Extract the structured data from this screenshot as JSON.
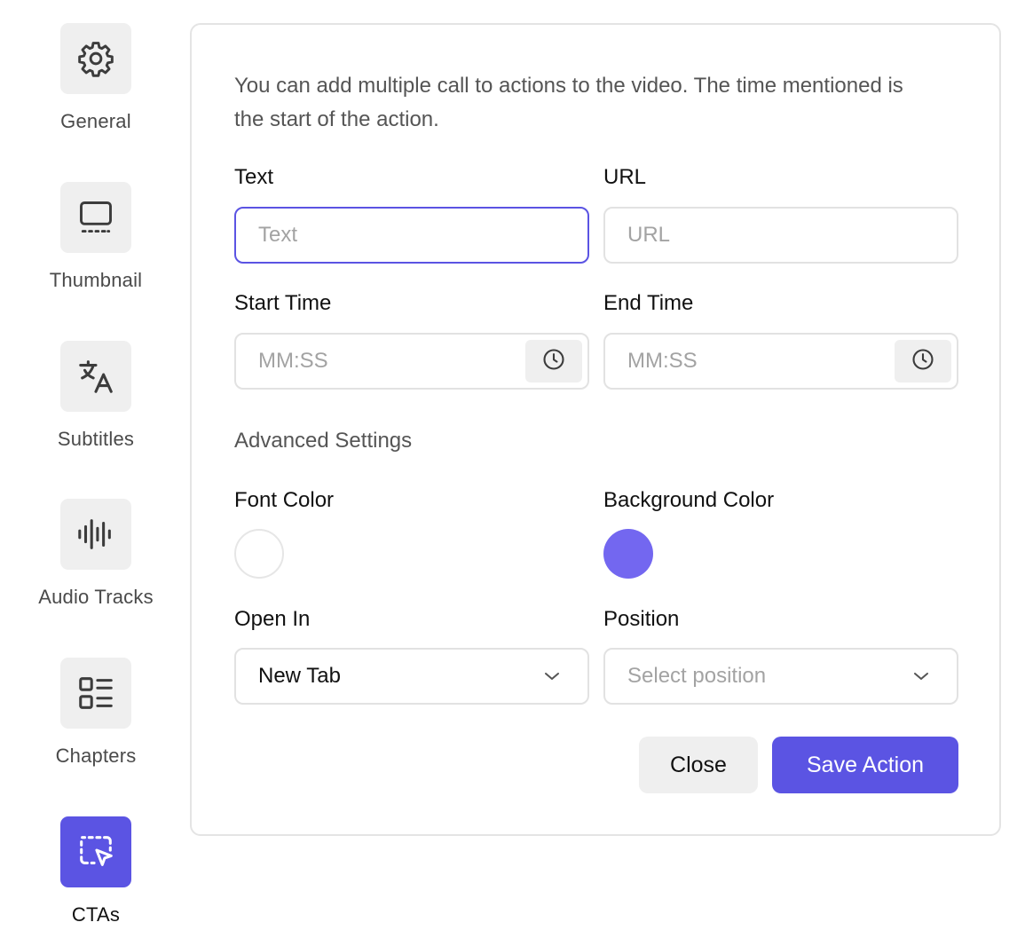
{
  "sidebar": {
    "items": [
      {
        "label": "General",
        "icon": "gear-icon"
      },
      {
        "label": "Thumbnail",
        "icon": "monitor-icon"
      },
      {
        "label": "Subtitles",
        "icon": "translate-icon"
      },
      {
        "label": "Audio Tracks",
        "icon": "audio-wave-icon"
      },
      {
        "label": "Chapters",
        "icon": "list-icon"
      },
      {
        "label": "CTAs",
        "icon": "select-cursor-icon",
        "active": true
      }
    ]
  },
  "form": {
    "intro": "You can add multiple call to actions to the video. The time mentioned is the start of the action.",
    "text_label": "Text",
    "text_placeholder": "Text",
    "text_value": "",
    "url_label": "URL",
    "url_placeholder": "URL",
    "url_value": "",
    "start_time_label": "Start Time",
    "start_time_placeholder": "MM:SS",
    "end_time_label": "End Time",
    "end_time_placeholder": "MM:SS",
    "advanced_title": "Advanced Settings",
    "font_color_label": "Font Color",
    "font_color_value": "#ffffff",
    "background_color_label": "Background Color",
    "background_color_value": "#7367f0",
    "open_in_label": "Open In",
    "open_in_value": "New Tab",
    "position_label": "Position",
    "position_placeholder": "Select position",
    "close_label": "Close",
    "save_label": "Save Action"
  },
  "colors": {
    "accent": "#5b54e3",
    "tile_bg": "#efefef",
    "border": "#e2e2e2",
    "muted_text": "#555555",
    "placeholder": "#a3a3a3"
  }
}
